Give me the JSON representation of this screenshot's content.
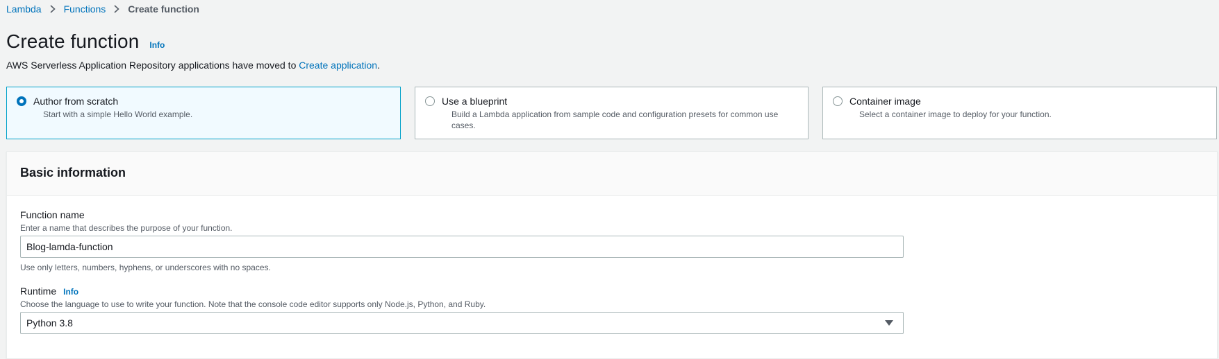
{
  "breadcrumb": {
    "items": [
      "Lambda",
      "Functions"
    ],
    "current": "Create function"
  },
  "header": {
    "title": "Create function",
    "info_label": "Info"
  },
  "notice": {
    "text_before": "AWS Serverless Application Repository applications have moved to ",
    "link_text": "Create application",
    "text_after": "."
  },
  "options": [
    {
      "title": "Author from scratch",
      "description": "Start with a simple Hello World example.",
      "selected": true
    },
    {
      "title": "Use a blueprint",
      "description": "Build a Lambda application from sample code and configuration presets for common use cases.",
      "selected": false
    },
    {
      "title": "Container image",
      "description": "Select a container image to deploy for your function.",
      "selected": false
    }
  ],
  "basic_info": {
    "title": "Basic information",
    "function_name": {
      "label": "Function name",
      "description": "Enter a name that describes the purpose of your function.",
      "value": "Blog-lamda-function",
      "constraint": "Use only letters, numbers, hyphens, or underscores with no spaces."
    },
    "runtime": {
      "label": "Runtime",
      "info_label": "Info",
      "description": "Choose the language to use to write your function. Note that the console code editor supports only Node.js, Python, and Ruby.",
      "value": "Python 3.8"
    }
  },
  "colors": {
    "link": "#0073bb",
    "selected_border": "#00a1c9",
    "selected_bg": "#f1faff",
    "page_bg": "#f2f3f3"
  }
}
